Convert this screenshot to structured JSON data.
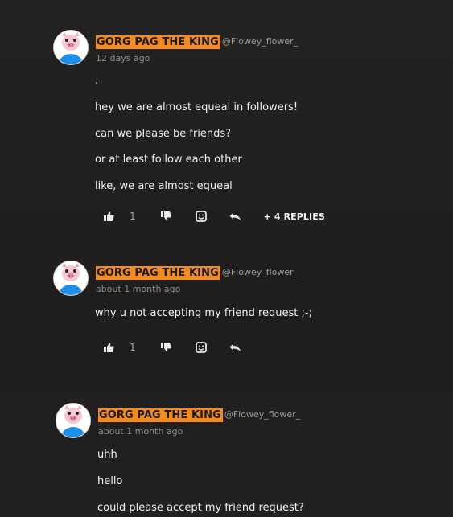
{
  "comments": [
    {
      "username": "GORG PAG THE KING",
      "handle": "@Flowey_flower_",
      "time": "12 days ago",
      "lines": [
        ".",
        "hey we are almost equeal in followers!",
        "can we please be friends?",
        "or at least follow each other",
        "like, we are almost equeal"
      ],
      "likes": "1",
      "replies_label": "+ 4 REPLIES"
    },
    {
      "username": "GORG PAG THE KING",
      "handle": "@Flowey_flower_",
      "time": "about 1 month ago",
      "lines": [
        "why u not accepting my friend request ;-;"
      ],
      "likes": "1"
    },
    {
      "username": "GORG PAG THE KING",
      "handle": "@Flowey_flower_",
      "time": "about 1 month ago",
      "lines": [
        "uhh",
        "hello",
        "could please accept my friend request?"
      ]
    }
  ],
  "icons": {
    "like": "thumbs-up-icon",
    "dislike": "thumbs-down-icon",
    "emoji": "emoji-icon",
    "reply": "reply-arrow-icon"
  },
  "colors": {
    "username_highlight": "#f58b1f",
    "background": "#1f1e1c"
  }
}
